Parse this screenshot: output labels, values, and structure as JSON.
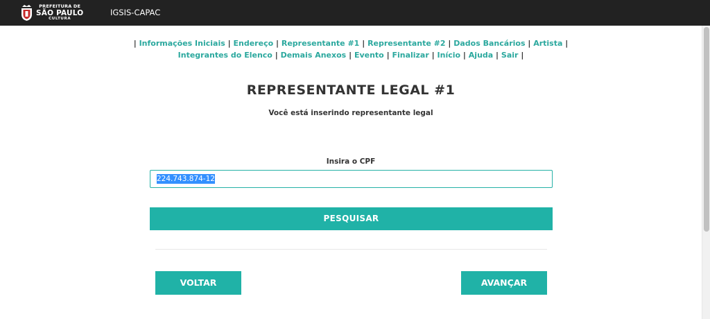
{
  "header": {
    "logo": {
      "line1": "PREFEITURA DE",
      "line2": "SÃO PAULO",
      "line3": "CULTURA",
      "icon": "coat-of-arms-icon"
    },
    "app_name": "IGSIS-CAPAC"
  },
  "menu": {
    "separator": "|",
    "items": [
      {
        "label": "Informações Iniciais"
      },
      {
        "label": "Endereço"
      },
      {
        "label": "Representante #1"
      },
      {
        "label": "Representante #2"
      },
      {
        "label": "Dados Bancários"
      },
      {
        "label": "Artista"
      },
      {
        "label": "Integrantes do Elenco"
      },
      {
        "label": "Demais Anexos"
      },
      {
        "label": "Evento"
      },
      {
        "label": "Finalizar"
      },
      {
        "label": "Início"
      },
      {
        "label": "Ajuda"
      },
      {
        "label": "Sair"
      }
    ]
  },
  "main": {
    "title": "REPRESENTANTE LEGAL #1",
    "subtitle": "Você está inserindo representante legal",
    "cpf_label": "Insira o CPF",
    "cpf_value": "224.743.874-12",
    "search_button": "PESQUISAR",
    "back_button": "VOLTAR",
    "next_button": "AVANÇAR"
  },
  "colors": {
    "accent": "#20b2a7",
    "link": "#2ba89e",
    "header_bg": "#222222",
    "selection": "#3390ff"
  }
}
